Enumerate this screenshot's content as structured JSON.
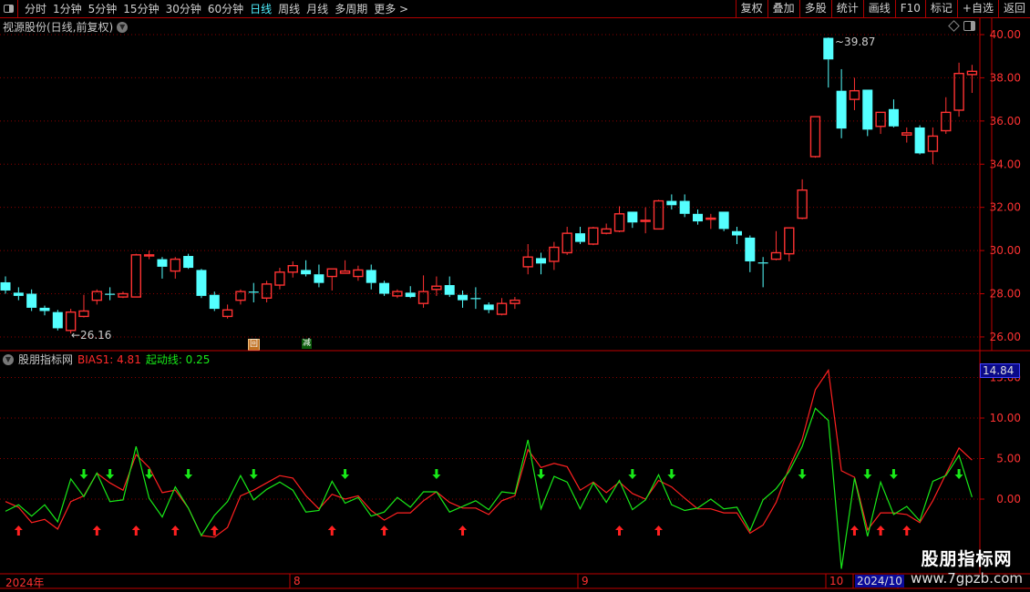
{
  "toolbar": {
    "periods": [
      "分时",
      "1分钟",
      "5分钟",
      "15分钟",
      "30分钟",
      "60分钟",
      "日线",
      "周线",
      "月线",
      "多周期",
      "更多 >"
    ],
    "active_period": "日线",
    "buttons": [
      "复权",
      "叠加",
      "多股",
      "统计",
      "画线",
      "F10",
      "标记",
      "+自选",
      "返回"
    ]
  },
  "price_panel": {
    "title": "视源股份(日线,前复权)",
    "max_label": "39.87",
    "min_label": "26.16",
    "y_ticks": [
      "40.00",
      "38.00",
      "36.00",
      "34.00",
      "32.00",
      "30.00",
      "28.00",
      "26.00"
    ],
    "markers": [
      "回",
      "减"
    ]
  },
  "indicator_panel": {
    "name": "股朋指标网",
    "bias_label": "BIAS1: 4.81",
    "start_label": "起动线: 0.25",
    "current_value": "14.84",
    "y_ticks": [
      "15.00",
      "10.00",
      "5.00",
      "0.00"
    ]
  },
  "date_axis": {
    "labels": [
      "2024年",
      "8",
      "9",
      "10"
    ],
    "cursor_date": "2024/10"
  },
  "watermark": {
    "line1": "股朋指标网",
    "line2": "www.7gpzb.com"
  },
  "colors": {
    "up": "#ff3232",
    "down": "#54ffff",
    "bias": "#ff2020",
    "start_line": "#18e818",
    "grid": "#8a0000",
    "axis": "#c00000"
  },
  "chart_data": [
    {
      "type": "candlestick",
      "ylim": [
        25.5,
        40.2
      ],
      "ohlc": [
        [
          28.53,
          28.8,
          28.0,
          28.15
        ],
        [
          28.05,
          28.3,
          27.7,
          27.9
        ],
        [
          28.0,
          28.2,
          27.2,
          27.35
        ],
        [
          27.35,
          27.45,
          27.0,
          27.2
        ],
        [
          27.15,
          27.25,
          26.3,
          26.4
        ],
        [
          26.3,
          27.3,
          26.16,
          27.15
        ],
        [
          26.95,
          27.95,
          26.9,
          27.2
        ],
        [
          27.7,
          28.2,
          27.5,
          28.1
        ],
        [
          28.0,
          28.3,
          27.7,
          27.95
        ],
        [
          27.85,
          28.1,
          27.8,
          28.0
        ],
        [
          27.85,
          29.85,
          27.85,
          29.8
        ],
        [
          29.75,
          30.0,
          29.6,
          29.8
        ],
        [
          29.6,
          29.7,
          28.7,
          29.25
        ],
        [
          29.05,
          29.7,
          28.7,
          29.6
        ],
        [
          29.75,
          29.85,
          29.15,
          29.2
        ],
        [
          29.1,
          29.15,
          27.8,
          27.9
        ],
        [
          27.95,
          28.1,
          27.2,
          27.3
        ],
        [
          26.95,
          27.5,
          26.85,
          27.25
        ],
        [
          27.7,
          28.2,
          27.5,
          28.1
        ],
        [
          28.1,
          28.5,
          27.6,
          28.05
        ],
        [
          27.8,
          28.6,
          27.6,
          28.45
        ],
        [
          28.4,
          29.2,
          28.2,
          29.0
        ],
        [
          29.0,
          29.5,
          28.75,
          29.3
        ],
        [
          29.1,
          29.55,
          28.8,
          28.9
        ],
        [
          28.9,
          29.35,
          28.3,
          28.5
        ],
        [
          28.8,
          29.15,
          28.15,
          29.15
        ],
        [
          28.95,
          29.55,
          28.95,
          29.05
        ],
        [
          28.8,
          29.3,
          28.6,
          29.1
        ],
        [
          29.1,
          29.35,
          28.2,
          28.5
        ],
        [
          28.5,
          28.6,
          27.9,
          28.0
        ],
        [
          27.9,
          28.2,
          27.8,
          28.1
        ],
        [
          28.05,
          28.35,
          27.8,
          27.85
        ],
        [
          27.55,
          28.85,
          27.35,
          28.1
        ],
        [
          28.2,
          28.8,
          27.9,
          28.35
        ],
        [
          28.4,
          28.8,
          27.85,
          27.95
        ],
        [
          27.95,
          28.15,
          27.35,
          27.7
        ],
        [
          27.8,
          28.3,
          27.3,
          27.75
        ],
        [
          27.5,
          27.6,
          27.1,
          27.25
        ],
        [
          27.05,
          27.8,
          27.0,
          27.55
        ],
        [
          27.55,
          27.85,
          27.3,
          27.7
        ],
        [
          29.25,
          30.3,
          28.9,
          29.7
        ],
        [
          29.65,
          29.9,
          28.9,
          29.4
        ],
        [
          29.5,
          30.4,
          29.1,
          30.15
        ],
        [
          29.9,
          31.1,
          29.8,
          30.8
        ],
        [
          30.8,
          31.1,
          30.3,
          30.4
        ],
        [
          30.3,
          31.1,
          30.25,
          31.05
        ],
        [
          30.8,
          31.25,
          30.75,
          31.0
        ],
        [
          30.9,
          32.05,
          30.85,
          31.7
        ],
        [
          31.8,
          31.8,
          31.05,
          31.3
        ],
        [
          31.35,
          32.0,
          30.8,
          31.4
        ],
        [
          31.0,
          32.35,
          31.0,
          32.3
        ],
        [
          32.3,
          32.6,
          31.9,
          32.1
        ],
        [
          32.3,
          32.6,
          31.55,
          31.7
        ],
        [
          31.7,
          31.9,
          31.2,
          31.35
        ],
        [
          31.45,
          31.7,
          31.0,
          31.5
        ],
        [
          31.8,
          31.8,
          30.9,
          31.0
        ],
        [
          30.9,
          31.1,
          30.3,
          30.7
        ],
        [
          30.6,
          30.7,
          29.0,
          29.5
        ],
        [
          29.45,
          29.7,
          28.3,
          29.4
        ],
        [
          29.6,
          30.9,
          29.55,
          29.9
        ],
        [
          29.85,
          31.05,
          29.5,
          31.05
        ],
        [
          31.5,
          33.3,
          31.45,
          32.8
        ],
        [
          34.35,
          36.2,
          34.3,
          36.2
        ],
        [
          39.85,
          39.87,
          37.55,
          38.85
        ],
        [
          37.4,
          38.4,
          35.2,
          35.65
        ],
        [
          37.0,
          38.0,
          36.5,
          37.4
        ],
        [
          37.45,
          37.45,
          35.3,
          35.6
        ],
        [
          35.75,
          36.4,
          35.4,
          36.4
        ],
        [
          36.55,
          37.0,
          35.7,
          35.75
        ],
        [
          35.35,
          35.7,
          35.0,
          35.45
        ],
        [
          35.7,
          35.8,
          34.45,
          34.5
        ],
        [
          34.6,
          35.7,
          34.0,
          35.3
        ],
        [
          35.55,
          37.1,
          35.4,
          36.4
        ],
        [
          36.5,
          38.7,
          36.2,
          38.2
        ],
        [
          38.15,
          38.6,
          37.3,
          38.3
        ]
      ]
    },
    {
      "type": "line",
      "ylim": [
        -9,
        16
      ],
      "series": [
        {
          "name": "BIAS1",
          "color": "#ff2020",
          "values": [
            -0.3,
            -1.0,
            -2.9,
            -2.5,
            -3.7,
            -0.3,
            0.4,
            3.2,
            2.0,
            1.1,
            5.5,
            3.9,
            0.8,
            1.1,
            -1.1,
            -4.5,
            -4.7,
            -3.5,
            0.4,
            1.1,
            2.0,
            2.9,
            2.6,
            0.4,
            -1.2,
            0.6,
            0.0,
            0.4,
            -1.4,
            -2.6,
            -1.7,
            -1.7,
            -0.2,
            0.9,
            -0.4,
            -1.1,
            -1.1,
            -1.9,
            -0.2,
            0.4,
            6.1,
            3.9,
            4.4,
            4.0,
            1.1,
            2.1,
            0.8,
            2.1,
            0.7,
            0.0,
            2.3,
            1.5,
            0.1,
            -1.2,
            -1.2,
            -1.7,
            -1.7,
            -4.2,
            -3.2,
            -0.4,
            3.9,
            7.4,
            13.5,
            15.9,
            3.5,
            2.7,
            -3.8,
            -1.7,
            -1.7,
            -1.9,
            -2.9,
            -0.2,
            3.1,
            6.3,
            4.81
          ]
        },
        {
          "name": "起动线",
          "color": "#18e818",
          "values": [
            -1.5,
            -0.7,
            -2.1,
            -0.7,
            -2.8,
            2.5,
            0.3,
            3.2,
            -0.3,
            -0.1,
            6.5,
            0.1,
            -2.2,
            1.5,
            -1.1,
            -4.5,
            -2.0,
            -0.3,
            2.9,
            -0.1,
            1.2,
            2.1,
            1.1,
            -1.6,
            -1.4,
            2.2,
            -0.5,
            0.2,
            -2.1,
            -1.6,
            0.2,
            -1.0,
            0.9,
            0.9,
            -1.6,
            -0.9,
            -0.2,
            -1.3,
            0.9,
            0.7,
            7.3,
            -1.2,
            2.8,
            2.1,
            -1.2,
            2.0,
            -0.4,
            2.3,
            -1.3,
            -0.1,
            3.0,
            -0.7,
            -1.4,
            -1.1,
            0.0,
            -1.2,
            -1.0,
            -3.9,
            -0.1,
            1.3,
            3.4,
            6.5,
            11.2,
            9.7,
            -8.6,
            2.6,
            -4.6,
            2.1,
            -1.9,
            -0.9,
            -2.7,
            2.2,
            2.9,
            5.4,
            0.25
          ]
        }
      ],
      "down_arrows_at": [
        6,
        8,
        11,
        14,
        19,
        26,
        33,
        41,
        48,
        51,
        61,
        66,
        68,
        73
      ],
      "up_arrows_at": [
        1,
        7,
        10,
        13,
        16,
        25,
        29,
        35,
        47,
        50,
        65,
        67,
        69
      ]
    }
  ]
}
